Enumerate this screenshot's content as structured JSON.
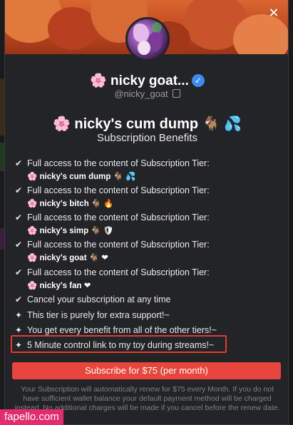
{
  "modal": {
    "close_label": "✕",
    "creator_name": "🌸 nicky goat...",
    "verified_icon": "check-badge-icon",
    "handle": "@nicky_goat",
    "tier_title": "🌸 nicky's cum dump 🐐 💦",
    "benefits_heading": "Subscription Benefits"
  },
  "benefits": [
    {
      "icon": "check-icon",
      "text": "Full access to the content of Subscription Tier:",
      "sub": "🌸 nicky's cum dump 🐐 💦"
    },
    {
      "icon": "check-icon",
      "text": "Full access to the content of Subscription Tier:",
      "sub": "🌸 nicky's bitch 🐐 🔥"
    },
    {
      "icon": "check-icon",
      "text": "Full access to the content of Subscription Tier:",
      "sub": "🌸 nicky's simp 🐐 🛡"
    },
    {
      "icon": "check-icon",
      "text": "Full access to the content of Subscription Tier:",
      "sub": "🌸 nicky's goat 🐐 ❤"
    },
    {
      "icon": "check-icon",
      "text": "Full access to the content of Subscription Tier:",
      "sub": "🌸 nicky's fan ❤"
    },
    {
      "icon": "check-icon",
      "text": "Cancel your subscription at any time"
    },
    {
      "icon": "sparkle-icon",
      "text": "This tier is purely for extra support!~"
    },
    {
      "icon": "sparkle-icon",
      "text": "You get every benefit from all of the other tiers!~"
    },
    {
      "icon": "sparkle-icon",
      "text": "5 Minute control link to my toy during streams!~"
    }
  ],
  "subscribe_button": "Subscribe for $75 (per month)",
  "footer_note": "Your Subscription will automatically renew for $75 every Month. If you do not have sufficient wallet balance your default payment method will be charged instead. No additional charges will be made if you cancel before the renew date.",
  "watermark": "fapello.com",
  "colors": {
    "accent": "#e8453c",
    "highlight": "#e23a2e",
    "verified": "#3d8bf2",
    "modal_bg": "#232427"
  }
}
